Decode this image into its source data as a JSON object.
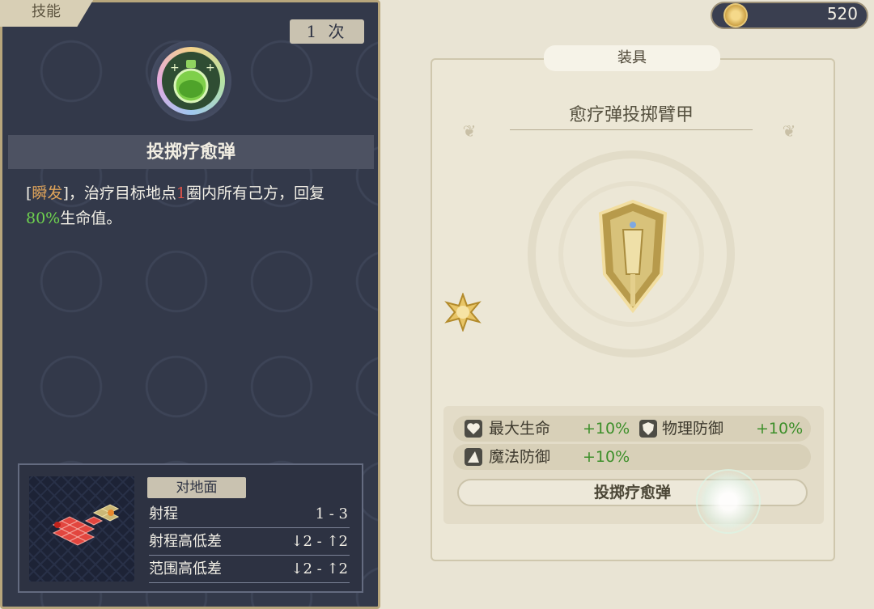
{
  "skill_panel": {
    "tab_label": "技能",
    "uses_count": "1",
    "uses_unit": "次",
    "skill_icon": "green-potion-icon",
    "skill_name": "投掷疗愈弹",
    "description": {
      "bracket_open": "[",
      "keyword": "瞬发",
      "bracket_close": "]",
      "part1": "，治疗目标地点",
      "radius": "1",
      "part2": "圈内所有己方，回复",
      "percent": "80%",
      "part3": "生命值。"
    },
    "range_info": {
      "target_type": "对地面",
      "rows": [
        {
          "label": "射程",
          "value": "1 - 3"
        },
        {
          "label": "射程高低差",
          "value": "↓2 - ↑2"
        },
        {
          "label": "范围高低差",
          "value": "↓2 - ↑2"
        }
      ]
    }
  },
  "currency": {
    "icon": "gold-coin-icon",
    "amount": "520"
  },
  "equipment": {
    "tab_label": "装具",
    "name": "愈疗弹投掷臂甲",
    "image": "golden-shield-icon",
    "badge": "gold-star-badge-icon",
    "stats": [
      {
        "icon": "heart-icon",
        "label": "最大生命",
        "value": "+10%"
      },
      {
        "icon": "shield-icon",
        "label": "物理防御",
        "value": "+10%"
      },
      {
        "icon": "wizard-hat-icon",
        "label": "魔法防御",
        "value": "+10%"
      }
    ],
    "linked_skill": "投掷疗愈弹"
  },
  "colors": {
    "panel_dark": "#33394a",
    "card_light": "#ece7d6",
    "highlight_gold": "#e0a45a",
    "highlight_red": "#e2544a",
    "highlight_green": "#6fd34f",
    "stat_green": "#3d8f2a"
  }
}
